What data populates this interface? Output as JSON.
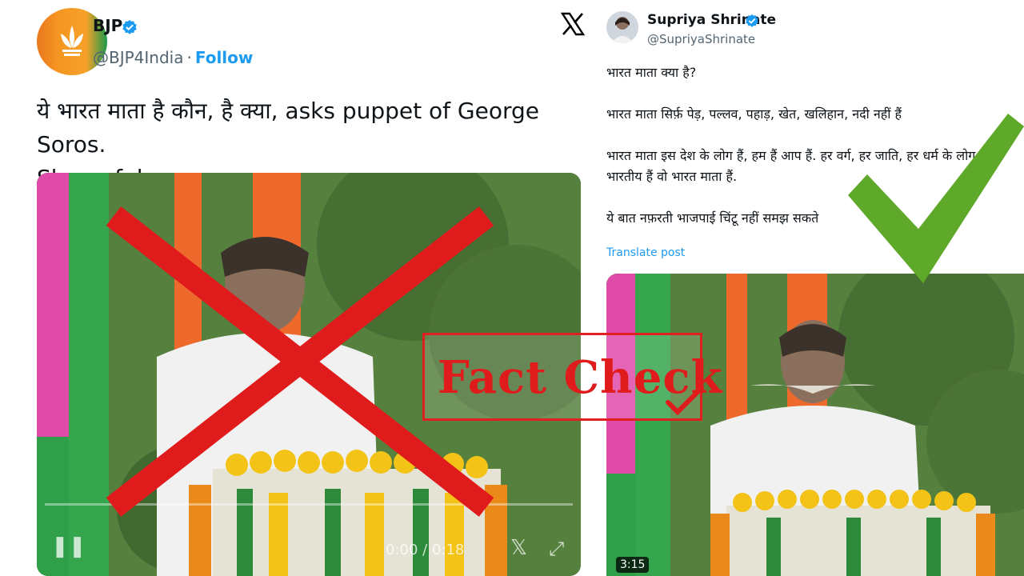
{
  "left_tweet": {
    "name": "BJP",
    "handle": "@BJP4India",
    "separator": "·",
    "follow_label": "Follow",
    "text_line1": "ये भारत माता है कौन, है क्या, asks puppet of George Soros.",
    "text_line2": "Shameful.",
    "video_time": "0:00 / 0:18"
  },
  "right_tweet": {
    "name": "Supriya Shrinate",
    "handle": "@SupriyaShrinate",
    "paragraphs": [
      "भारत माता क्या है?",
      "भारत माता सिर्फ़ पेड़, पल्लव, पहाड़, खेत, खलिहान, नदी नहीं हैं",
      "भारत माता इस देश के लोग हैं, हम हैं आप हैं. हर वर्ग, हर जाति, हर धर्म के लोग जो भारतीय हैं वो भारत माता हैं.",
      "ये बात नफ़रती भाजपाई चिंटू नहीं समझ सकते"
    ],
    "translate_label": "Translate post",
    "video_duration": "3:15"
  },
  "overlay": {
    "fact_check_label": "Fact Check"
  },
  "colors": {
    "verified": "#1d9bf0",
    "link": "#1d9bf0",
    "red_overlay": "#e01b1b",
    "green_tick": "#5ea82a",
    "bjp_saffron": "#f59522",
    "bjp_green": "#1d9a4a"
  },
  "icons": [
    "verified-badge-icon",
    "x-logo-icon",
    "pause-icon",
    "x-share-icon",
    "fullscreen-icon",
    "lotus-icon"
  ]
}
